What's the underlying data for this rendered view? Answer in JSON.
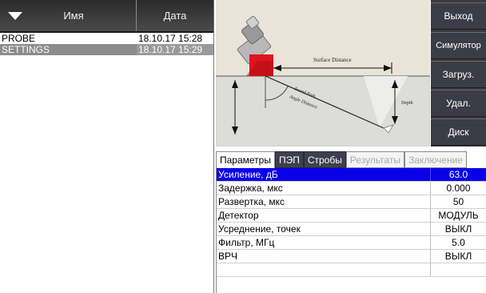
{
  "file_list": {
    "header": {
      "name_label": "Имя",
      "date_label": "Дата"
    },
    "rows": [
      {
        "name": "PROBE",
        "date": "18.10.17 15:28",
        "selected": false
      },
      {
        "name": "SETTINGS",
        "date": "18.10.17 15:29",
        "selected": true
      }
    ]
  },
  "diagram": {
    "surface_distance": "Surface Distance",
    "sound_path": "Sound Path",
    "angle_distance": "Angle Distance",
    "depth": "Depth"
  },
  "buttons": {
    "exit": "Выход",
    "simulator": "Симулятор",
    "load": "Загруз.",
    "delete": "Удал.",
    "disk": "Диск"
  },
  "tabs": [
    {
      "label": "Параметры",
      "state": "active"
    },
    {
      "label": "ПЭП",
      "state": "dark"
    },
    {
      "label": "Стробы",
      "state": "dark"
    },
    {
      "label": "Результаты",
      "state": "disabled"
    },
    {
      "label": "Заключение",
      "state": "disabled"
    }
  ],
  "params": [
    {
      "label": "Усиление, дБ",
      "value": "63.0",
      "selected": true
    },
    {
      "label": "Задержка, мкс",
      "value": "0.000",
      "selected": false
    },
    {
      "label": "Развертка, мкс",
      "value": "50",
      "selected": false
    },
    {
      "label": "Детектор",
      "value": "МОДУЛЬ",
      "selected": false
    },
    {
      "label": "Усреднение, точек",
      "value": "ВЫКЛ",
      "selected": false
    },
    {
      "label": "Фильтр, МГц",
      "value": "5.0",
      "selected": false
    },
    {
      "label": "ВРЧ",
      "value": "ВЫКЛ",
      "selected": false
    }
  ],
  "colors": {
    "selection_blue": "#0a00e8",
    "probe_wedge_red": "#e0141e",
    "header_dark": "#2b2b2b",
    "button_dark": "#3c3c46"
  }
}
